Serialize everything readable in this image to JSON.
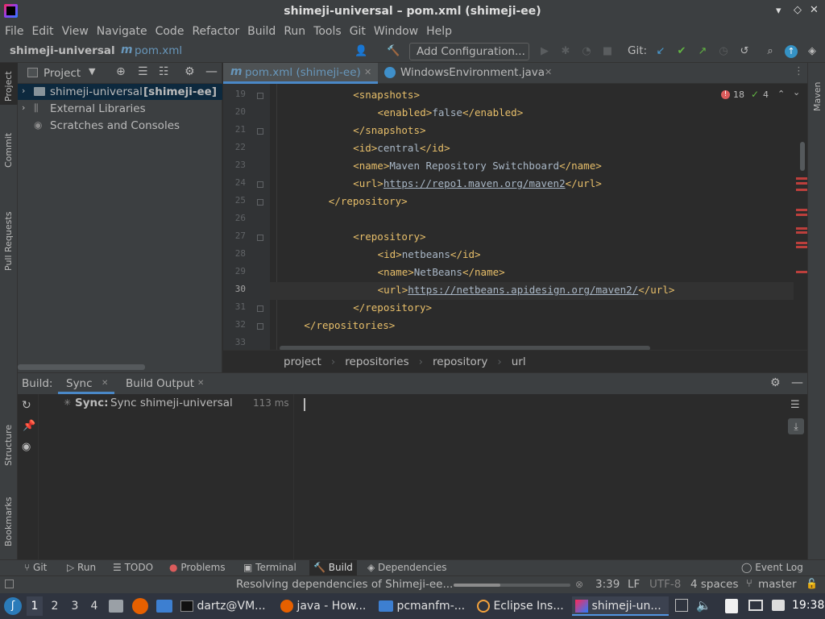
{
  "window": {
    "title": "shimeji-universal – pom.xml (shimeji-ee)"
  },
  "menu": [
    "File",
    "Edit",
    "View",
    "Navigate",
    "Code",
    "Refactor",
    "Build",
    "Run",
    "Tools",
    "Git",
    "Window",
    "Help"
  ],
  "nav": {
    "project": "shimeji-universal",
    "file": "pom.xml",
    "add_config": "Add Configuration...",
    "git_label": "Git:"
  },
  "left_strip": [
    "Project",
    "Commit",
    "Pull Requests",
    "Structure",
    "Bookmarks"
  ],
  "right_strip": [
    "Maven"
  ],
  "project_panel": {
    "title": "Project",
    "items": [
      {
        "name": "shimeji-universal",
        "module": "[shimeji-ee]"
      },
      {
        "name": "External Libraries"
      },
      {
        "name": "Scratches and Consoles"
      }
    ]
  },
  "editor": {
    "tabs": [
      "pom.xml (shimeji-ee)",
      "WindowsEnvironment.java"
    ],
    "errors": "18",
    "warnings": "4",
    "lines": [
      {
        "n": "19",
        "indent": 3,
        "parts": [
          [
            "t",
            "<snapshots>"
          ]
        ]
      },
      {
        "n": "20",
        "indent": 4,
        "parts": [
          [
            "t",
            "<enabled>"
          ],
          [
            "x",
            "false"
          ],
          [
            "t",
            "</enabled>"
          ]
        ]
      },
      {
        "n": "21",
        "indent": 3,
        "parts": [
          [
            "t",
            "</snapshots>"
          ]
        ]
      },
      {
        "n": "22",
        "indent": 3,
        "parts": [
          [
            "t",
            "<id>"
          ],
          [
            "x",
            "central"
          ],
          [
            "t",
            "</id>"
          ]
        ]
      },
      {
        "n": "23",
        "indent": 3,
        "parts": [
          [
            "t",
            "<name>"
          ],
          [
            "x",
            "Maven Repository Switchboard"
          ],
          [
            "t",
            "</name>"
          ]
        ]
      },
      {
        "n": "24",
        "indent": 3,
        "parts": [
          [
            "t",
            "<url>"
          ],
          [
            "u",
            "https://repo1.maven.org/maven2"
          ],
          [
            "t",
            "</url>"
          ]
        ]
      },
      {
        "n": "25",
        "indent": 2,
        "parts": [
          [
            "t",
            "</repository>"
          ]
        ]
      },
      {
        "n": "26",
        "indent": 0,
        "parts": []
      },
      {
        "n": "27",
        "indent": 3,
        "parts": [
          [
            "t",
            "<repository>"
          ]
        ]
      },
      {
        "n": "28",
        "indent": 4,
        "parts": [
          [
            "t",
            "<id>"
          ],
          [
            "x",
            "netbeans"
          ],
          [
            "t",
            "</id>"
          ]
        ]
      },
      {
        "n": "29",
        "indent": 4,
        "parts": [
          [
            "t",
            "<name>"
          ],
          [
            "x",
            "NetBeans"
          ],
          [
            "t",
            "</name>"
          ]
        ]
      },
      {
        "n": "30",
        "indent": 4,
        "parts": [
          [
            "t",
            "<url>"
          ],
          [
            "u",
            "https://netbeans.apidesign.org/maven2/"
          ],
          [
            "t",
            "</url>"
          ]
        ]
      },
      {
        "n": "31",
        "indent": 3,
        "parts": [
          [
            "t",
            "</repository>"
          ]
        ]
      },
      {
        "n": "32",
        "indent": 1,
        "parts": [
          [
            "t",
            "</repositories>"
          ]
        ]
      },
      {
        "n": "33",
        "indent": 0,
        "parts": []
      }
    ],
    "breadcrumbs": [
      "project",
      "repositories",
      "repository",
      "url"
    ]
  },
  "build": {
    "label": "Build:",
    "tabs": [
      "Sync",
      "Build Output"
    ],
    "sync_label": "Sync:",
    "sync_text": "Sync shimeji-universal",
    "sync_time": "113 ms"
  },
  "bottom_tools": [
    "Git",
    "Run",
    "TODO",
    "Problems",
    "Terminal",
    "Build",
    "Dependencies"
  ],
  "event_log": "Event Log",
  "status": {
    "message": "Resolving dependencies of Shimeji-ee...",
    "position": "3:39",
    "line_sep": "LF",
    "encoding": "UTF-8",
    "indent": "4 spaces",
    "branch": "master"
  },
  "taskbar": {
    "workspaces": [
      "1",
      "2",
      "3",
      "4"
    ],
    "tasks": [
      "dartz@VM...",
      "java - How...",
      "pcmanfm-...",
      "Eclipse Ins...",
      "shimeji-un..."
    ],
    "clock": "19:38"
  }
}
